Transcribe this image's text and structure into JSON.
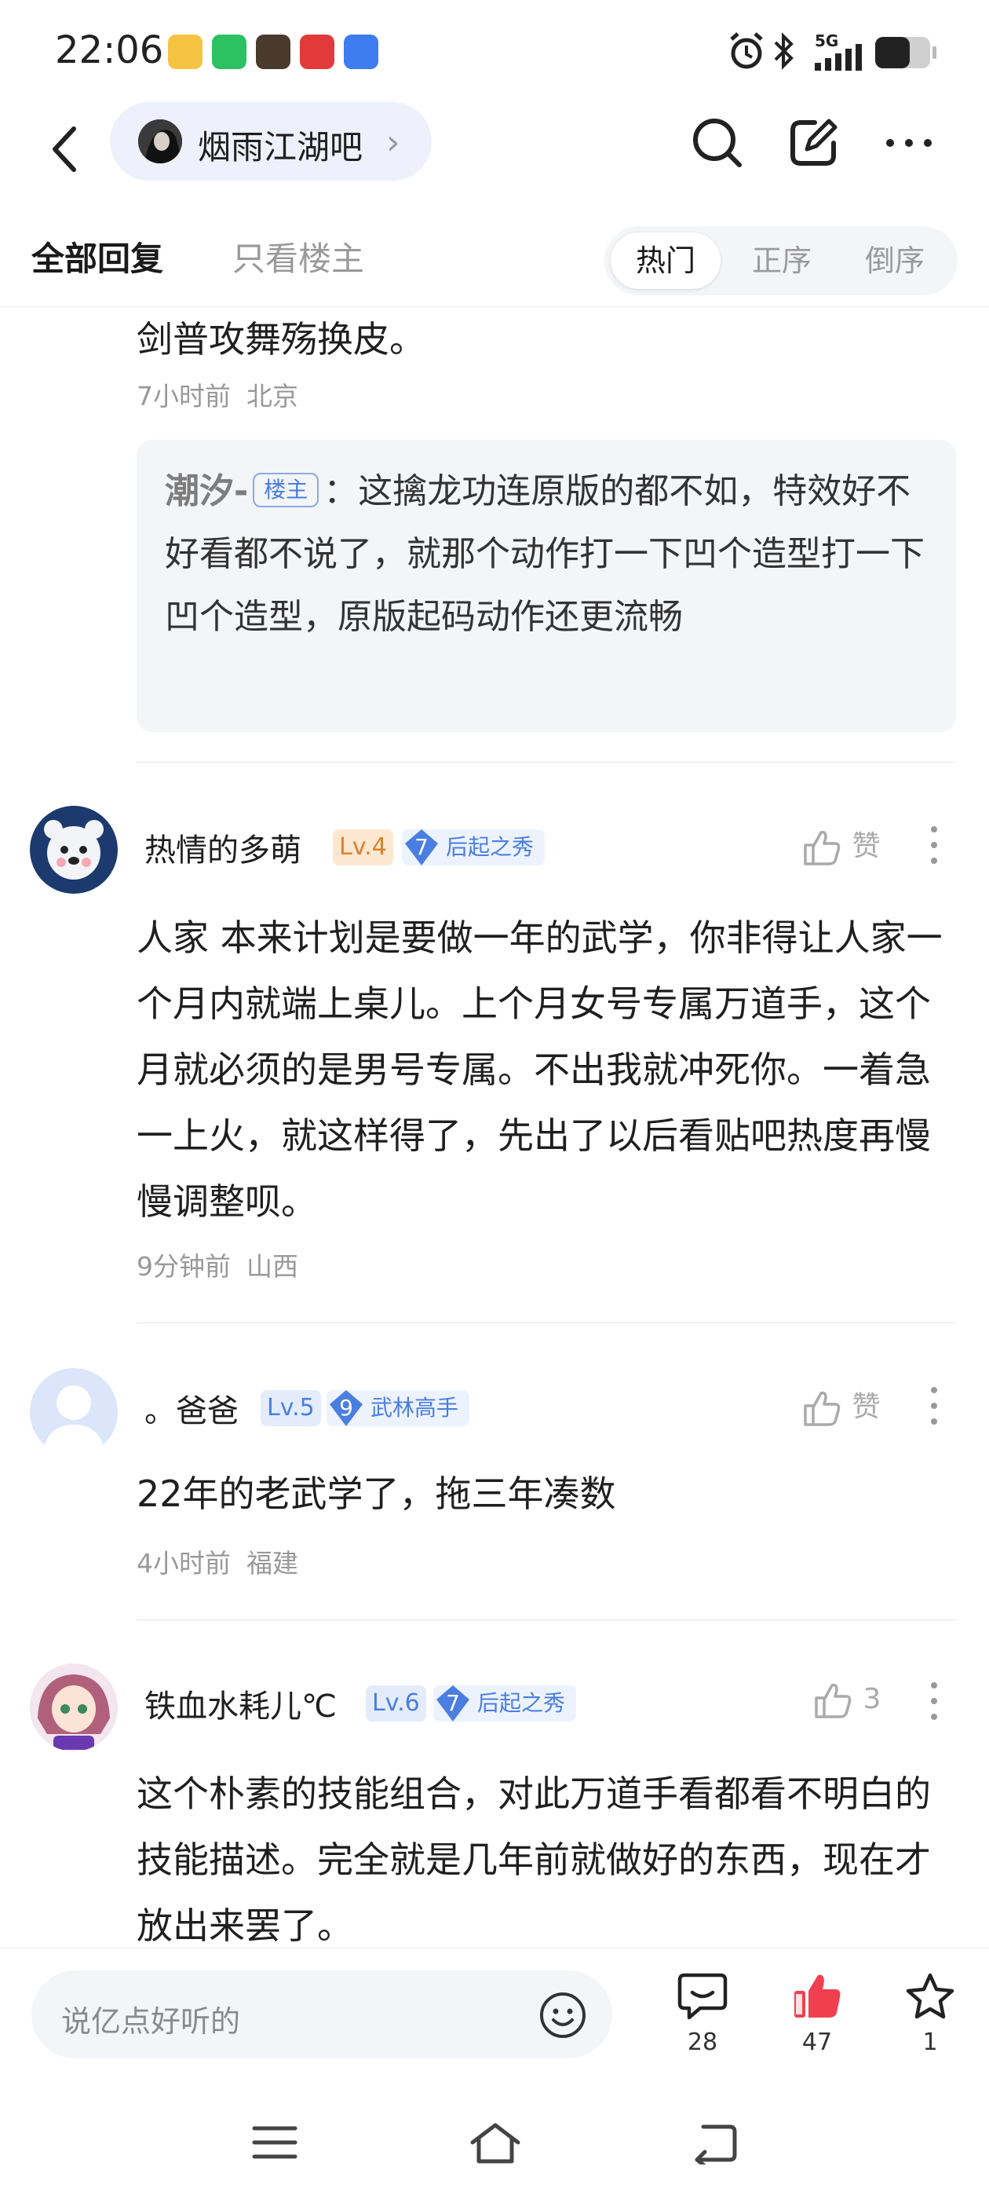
{
  "status_bar": {
    "time": "22:06",
    "network": "5G"
  },
  "nav": {
    "forum_name": "烟雨江湖吧"
  },
  "tabs": {
    "all_replies": "全部回复",
    "owner_only": "只看楼主",
    "sort_options": [
      "热门",
      "正序",
      "倒序"
    ],
    "active_sort": "热门"
  },
  "partial_post": {
    "text_tail": "剑普攻舞殇换皮。",
    "time": "7小时前",
    "location": "北京",
    "quote": {
      "author": "潮汐-",
      "badge": "楼主",
      "text": "：这擒龙功连原版的都不如，特效好不好看都不说了，就那个动作打一下凹个造型打一下凹个造型，原版起码动作还更流畅"
    }
  },
  "comments": [
    {
      "username": "热情的多萌",
      "level": "Lv.4",
      "title_num": "7",
      "title": "后起之秀",
      "like_label": "赞",
      "text": "人家 本来计划是要做一年的武学，你非得让人家一个月内就端上桌儿。上个月女号专属万道手，这个月就必须的是男号专属。不出我就冲死你。一着急一上火，就这样得了，先出了以后看贴吧热度再慢慢调整呗。",
      "time": "9分钟前",
      "location": "山西"
    },
    {
      "username": "。爸爸",
      "level": "Lv.5",
      "title_num": "9",
      "title": "武林高手",
      "like_label": "赞",
      "text": "22年的老武学了，拖三年凑数",
      "time": "4小时前",
      "location": "福建"
    },
    {
      "username": "铁血水耗儿℃",
      "level": "Lv.6",
      "title_num": "7",
      "title": "后起之秀",
      "like_label": "3",
      "text": "这个朴素的技能组合，对此万道手看都看不明白的技能描述。完全就是几年前就做好的东西，现在才放出来罢了。"
    }
  ],
  "bottom_bar": {
    "input_placeholder": "说亿点好听的",
    "comment_count": "28",
    "like_count": "47",
    "fav_count": "1"
  },
  "colors": {
    "accent_blue": "#4a7ee0",
    "like_red": "#f0404f",
    "level_orange": "#d9822b"
  }
}
